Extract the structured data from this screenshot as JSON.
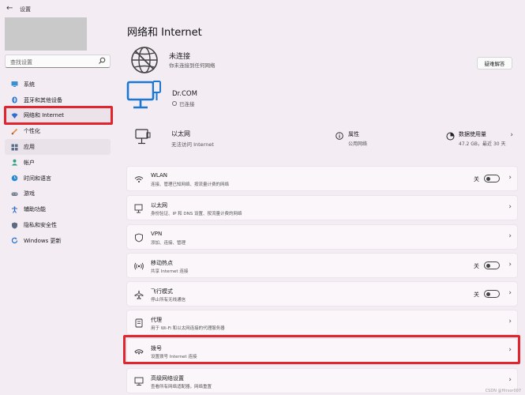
{
  "window": {
    "title": "设置"
  },
  "search": {
    "placeholder": "查找设置"
  },
  "sidebar": {
    "items": [
      {
        "label": "系统",
        "icon": "monitor-icon"
      },
      {
        "label": "蓝牙和其他设备",
        "icon": "bluetooth-icon"
      },
      {
        "label": "网络和 Internet",
        "icon": "wifi-icon"
      },
      {
        "label": "个性化",
        "icon": "brush-icon"
      },
      {
        "label": "应用",
        "icon": "apps-icon"
      },
      {
        "label": "帐户",
        "icon": "person-icon"
      },
      {
        "label": "时间和语言",
        "icon": "globe-clock-icon"
      },
      {
        "label": "游戏",
        "icon": "gamepad-icon"
      },
      {
        "label": "辅助功能",
        "icon": "accessibility-icon"
      },
      {
        "label": "隐私和安全性",
        "icon": "shield-icon"
      },
      {
        "label": "Windows 更新",
        "icon": "update-icon"
      }
    ]
  },
  "main": {
    "title": "网络和 Internet",
    "status": {
      "title": "未连接",
      "subtitle": "你未连接到任何网络",
      "troubleshoot_label": "疑难解答"
    },
    "dialup": {
      "name": "Dr.COM",
      "status": "已连接"
    },
    "ethernet": {
      "title": "以太网",
      "subtitle": "无法访问 Internet",
      "properties_title": "属性",
      "properties_sub": "公用网络",
      "usage_title": "数据使用量",
      "usage_sub": "47.2 GB，最近 30 天"
    },
    "rows": [
      {
        "title": "WLAN",
        "subtitle": "连接、管理已知网络、按流量计费的网络",
        "toggle_label": "关",
        "icon": "wifi-icon"
      },
      {
        "title": "以太网",
        "subtitle": "身份验证、IP 和 DNS 设置、按流量计费的网络",
        "toggle_label": "",
        "icon": "ethernet-icon"
      },
      {
        "title": "VPN",
        "subtitle": "添加、连接、管理",
        "toggle_label": "",
        "icon": "vpn-shield-icon"
      },
      {
        "title": "移动热点",
        "subtitle": "共享 Internet 连接",
        "toggle_label": "关",
        "icon": "hotspot-icon"
      },
      {
        "title": "飞行模式",
        "subtitle": "停止所有无线通信",
        "toggle_label": "关",
        "icon": "airplane-icon"
      },
      {
        "title": "代理",
        "subtitle": "用于 Wi-Fi 和以太网连接的代理服务器",
        "toggle_label": "",
        "icon": "proxy-icon"
      },
      {
        "title": "拨号",
        "subtitle": "设置拨号 Internet 连接",
        "toggle_label": "",
        "icon": "dialup-icon"
      },
      {
        "title": "高级网络设置",
        "subtitle": "查看所有网络适配器，网络重置",
        "toggle_label": "",
        "icon": "advanced-network-icon"
      }
    ]
  },
  "colors": {
    "highlight": "#e0252f",
    "background": "#f3ecf3",
    "accent": "#1a73e8"
  },
  "watermark": "CSDN @Hirsor007"
}
